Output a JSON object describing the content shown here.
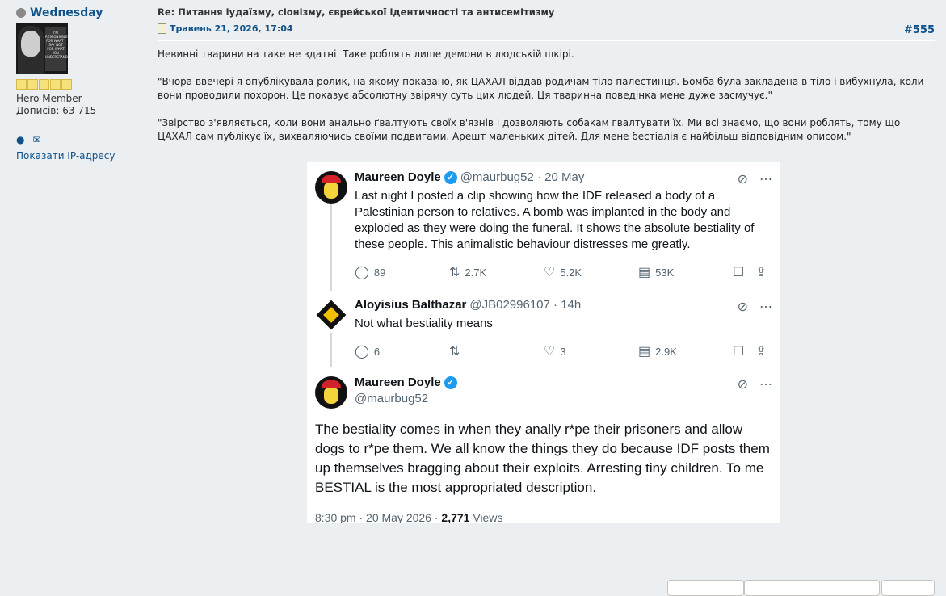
{
  "author": {
    "username": "Wednesday",
    "avatar_text": "I'M RESPONSIBLE FOR WHAT I SAY NOT FOR WHAT YOU UNDERSTAND",
    "rank": "Hero Member",
    "posts_label": "Дописів: 63 715",
    "show_ip": "Показати IP-адресу"
  },
  "post": {
    "title": "Re: Питання іудаїзму, сіонізму, єврейської ідентичності та антисемітизму",
    "date": "Травень 21, 2026, 17:04",
    "number": "#555",
    "paragraphs": [
      "Невинні тварини на таке не здатні. Таке роблять лише демони в людській шкірі.",
      "\"Вчора ввечері я опублікувала ролик, на якому показано, як ЦАХАЛ віддав родичам тіло палестинця. Бомба була закладена в тіло і вибухнула, коли вони проводили похорон. Це показує абсолютну звірячу суть цих людей. Ця тваринна поведінка мене дуже засмучує.\"",
      "\"Звірство з'являється, коли вони анально ґвалтують своїх в'язнів і дозволяють собакам ґвалтувати їх. Ми всі знаємо, що вони роблять, тому що ЦАХАЛ сам публікує їх, вихваляючись своїми подвигами. Арешт маленьких дітей. Для мене бестіалія є найбільш відповідним описом.\""
    ]
  },
  "tweets": [
    {
      "name": "Maureen Doyle",
      "handle": "@maurbug52 · 20 May",
      "text": "Last night I posted a clip showing how the IDF released a body of a Palestinian person to relatives. A bomb was implanted in the body and exploded as they were doing the funeral. It shows the absolute bestiality of these people. This animalistic behaviour distresses me greatly.",
      "replies": "89",
      "reposts": "2.7K",
      "likes": "5.2K",
      "views": "53K"
    },
    {
      "name": "Aloyisius Balthazar",
      "handle": "@JB02996107 · 14h",
      "text": "Not what bestiality means",
      "replies": "6",
      "reposts": "",
      "likes": "3",
      "views": "2.9K"
    },
    {
      "name": "Maureen Doyle",
      "handle": "@maurbug52",
      "text": "The bestiality comes in when they anally r*pe their prisoners and allow dogs to r*pe them. We all know the things they do because IDF posts them up themselves bragging about their exploits. Arresting tiny children. To me BESTIAL is the most appropriated description.",
      "time": "8:30 pm · 20 May 2026 · ",
      "views_count": "2,771",
      "views_label": "Views"
    }
  ]
}
